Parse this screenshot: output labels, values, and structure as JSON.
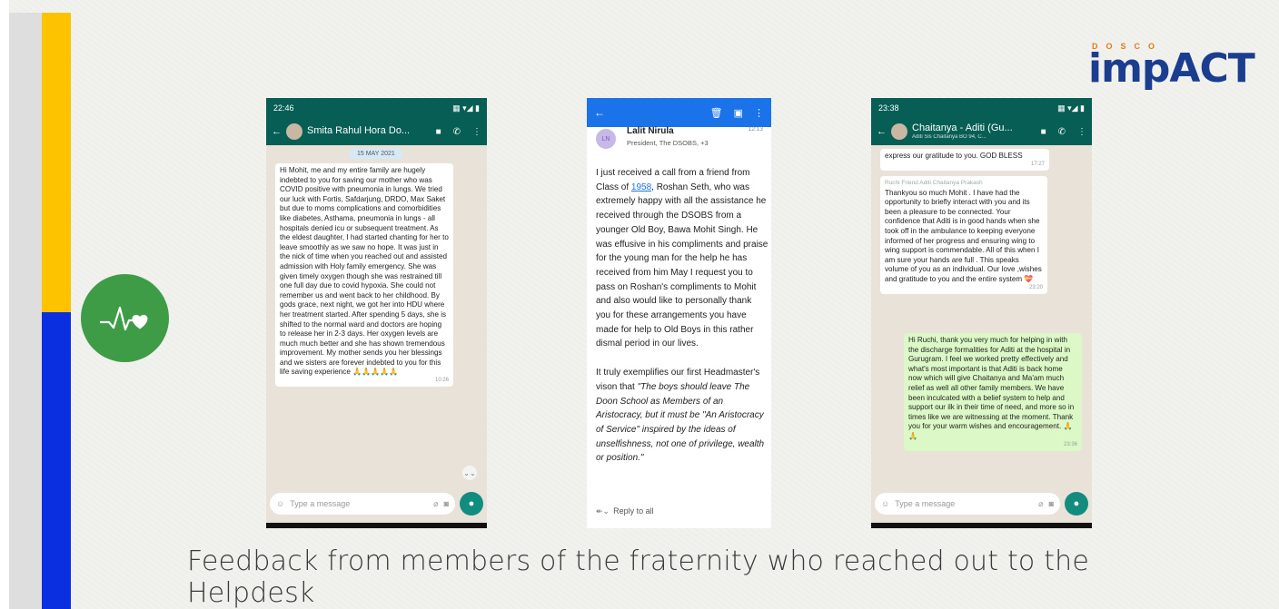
{
  "caption": "Feedback from members of the fraternity who reached out to the Helpdesk",
  "logo": {
    "small": "DOSCO",
    "main": "impACT"
  },
  "badge": {
    "icon": "heartbeat-heart-icon"
  },
  "colors": {
    "yellow": "#fdc300",
    "blue": "#0a2fe0",
    "green": "#3e9c47",
    "whatsapp": "#075e54",
    "gmail": "#1a73e8"
  },
  "phone1": {
    "status_time": "22:46",
    "contact": "Smita Rahul Hora Do...",
    "date_chip": "15 MAY 2021",
    "message": "Hi Mohit, me and my entire family are hugely indebted to you for saving our mother who was COVID positive with pneumonia in lungs. We tried our luck with Fortis, Safdarjung, DRDO, Max Saket but due to moms complications and comorbidities like diabetes, Asthama, pneumonia in lungs - all hospitals denied icu or subsequent treatment. As the eldest daughter, I had started chanting for her to leave smoothly as we saw no hope. It was just in the nick of time when you reached out and assisted admission with Holy family emergency. She was given timely oxygen though she was restrained till one full day due to covid hypoxia. She could not remember us and went back to her childhood. By gods grace, next night, we got her into HDU where her treatment started. After spending 5 days, she is shifted to the normal ward and doctors are hoping to release her in 2-3 days. Her oxygen levels are much much better and she has shown tremendous improvement. My mother sends you her blessings and we sisters are forever indebted to you for this life saving experience 🙏🙏🙏🙏🙏",
    "message_time": "10:26",
    "input_placeholder": "Type a message"
  },
  "phone2": {
    "sender_initials": "LN",
    "sender_name": "Lalit Nirula",
    "sender_title": "President, The DSOBS, +3",
    "time": "12:13",
    "para1_a": "I just received a call from a friend from Class of ",
    "para1_link": "1958",
    "para1_b": ", Roshan Seth, who was extremely happy with all the assistance he received through the DSOBS from a younger Old Boy, Bawa Mohit Singh.  He was effusive in his compliments and praise for the young man for the help he has received from him  May I request you to pass on Roshan's compliments to Mohit and also would like to personally thank you for these arrangements you have made for help to Old Boys in this rather dismal period in our lives.",
    "para2_a": "It truly exemplifies our first Headmaster's vison that ",
    "para2_quote": "\"The boys should leave The Doon School as Members of an Aristocracy, but it must be \"An Aristocracy of Service\" inspired by the ideas of unselfishness, not one of privilege, wealth or position.\"",
    "reply": "Reply to all"
  },
  "phone3": {
    "status_time": "23:38",
    "contact": "Chaitanya - Aditi (Gu...",
    "contact_sub": "Aditi Sis Chaitanya BO 94, C...",
    "msg0": "express our gratitude to you. GOD BLESS",
    "msg0_time": "17:27",
    "msg1_sender": "Ruchi Friend Aditi Chaitanya Prakash",
    "msg1": "Thankyou so much Mohit . I have had the opportunity to briefly interact with you and its been a pleasure to be connected. Your confidence that Aditi is in good hands when she took off in the ambulance to keeping everyone informed of her progress and ensuring wing to wing support is commendable. All of this when I am sure your hands are full . This speaks volume of you as an individual. Our love ,wishes and gratitude to you and the entire system 💝",
    "msg1_time": "23:20",
    "msg2": "Hi Ruchi, thank you very much for helping in with the discharge formalities for Aditi at the hospital in Gurugram. I feel we worked pretty effectively and what's most important is that Aditi is back home now which will give Chaitanya and Ma'am much relief as well all other family members. We have been inculcated with a belief system to help and support our ilk in their time of need, and more so in times like we are witnessing at the moment. Thank you for your warm wishes and encouragement. 🙏🙏",
    "msg2_time": "23:36",
    "input_placeholder": "Type a message"
  }
}
